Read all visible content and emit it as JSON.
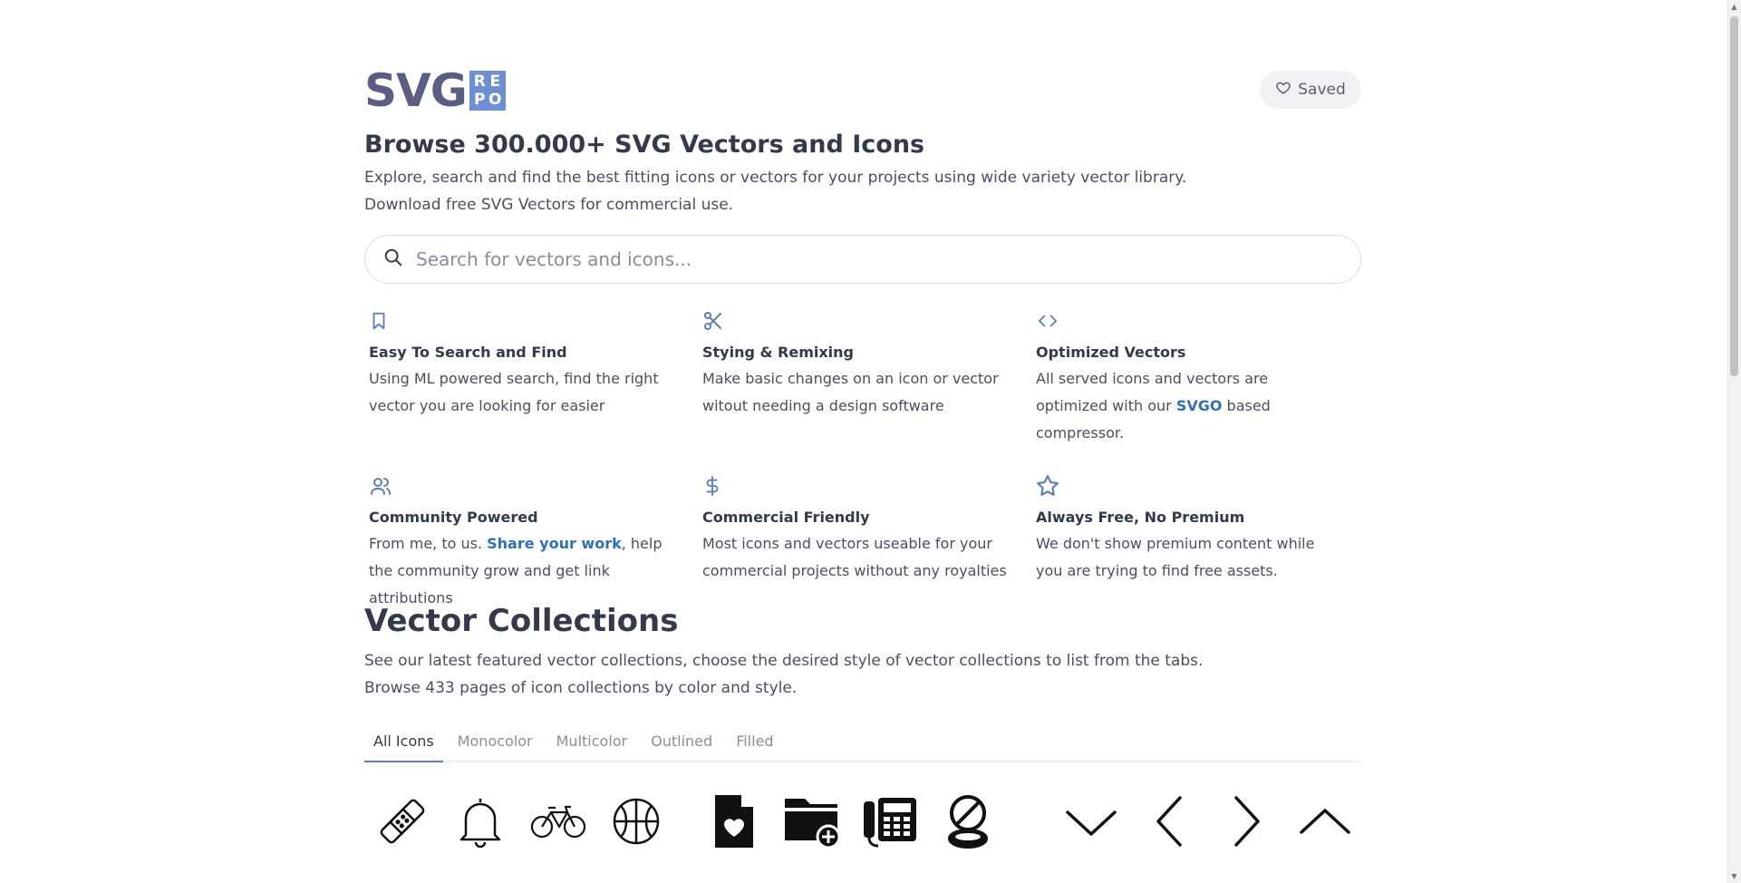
{
  "header": {
    "logo_text": "SVG",
    "logo_box_letters": [
      "R",
      "E",
      "P",
      "O"
    ],
    "saved_label": "Saved"
  },
  "hero": {
    "title": "Browse 300.000+ SVG Vectors and Icons",
    "description_line1": "Explore, search and find the best fitting icons or vectors for your projects using wide variety vector library.",
    "description_line2": "Download free SVG Vectors for commercial use."
  },
  "search": {
    "placeholder": "Search for vectors and icons..."
  },
  "features": [
    {
      "icon": "bookmark-icon",
      "title": "Easy To Search and Find",
      "body": "Using ML powered search, find the right vector you are looking for easier"
    },
    {
      "icon": "scissors-icon",
      "title": "Stying & Remixing",
      "body": "Make basic changes on an icon or vector witout needing a design software"
    },
    {
      "icon": "code-icon",
      "title": "Optimized Vectors",
      "body_before": "All served icons and vectors are optimized with our ",
      "link": "SVGO",
      "body_after": " based compressor."
    },
    {
      "icon": "users-icon",
      "title": "Community Powered",
      "body_before": "From me, to us. ",
      "link": "Share your work",
      "body_after": ", help the community grow and get link attributions"
    },
    {
      "icon": "dollar-icon",
      "title": "Commercial Friendly",
      "body": "Most icons and vectors useable for your commercial projects without any royalties"
    },
    {
      "icon": "star-icon",
      "title": "Always Free, No Premium",
      "body": "We don't show premium content while you are trying to find free assets."
    }
  ],
  "collections": {
    "title": "Vector Collections",
    "description_line1": "See our latest featured vector collections, choose the desired style of vector collections to list from the tabs.",
    "description_line2": "Browse 433 pages of icon collections by color and style.",
    "tabs": [
      {
        "label": "All Icons",
        "active": true
      },
      {
        "label": "Monocolor",
        "active": false
      },
      {
        "label": "Multicolor",
        "active": false
      },
      {
        "label": "Outlined",
        "active": false
      },
      {
        "label": "Filled",
        "active": false
      }
    ],
    "preview_icons": [
      "bandage-icon",
      "bell-icon",
      "bicycle-icon",
      "basketball-icon",
      "file-heart-icon",
      "folder-add-icon",
      "office-phone-icon",
      "compact-mirror-icon",
      "chevron-down-icon",
      "chevron-left-icon",
      "chevron-right-icon",
      "chevron-up-icon"
    ]
  },
  "colors": {
    "accent": "#5b7fb5",
    "link": "#2f6fb5",
    "logo": "#5b5e82",
    "logo_box": "#6f8fd0",
    "text": "#353a4b"
  }
}
